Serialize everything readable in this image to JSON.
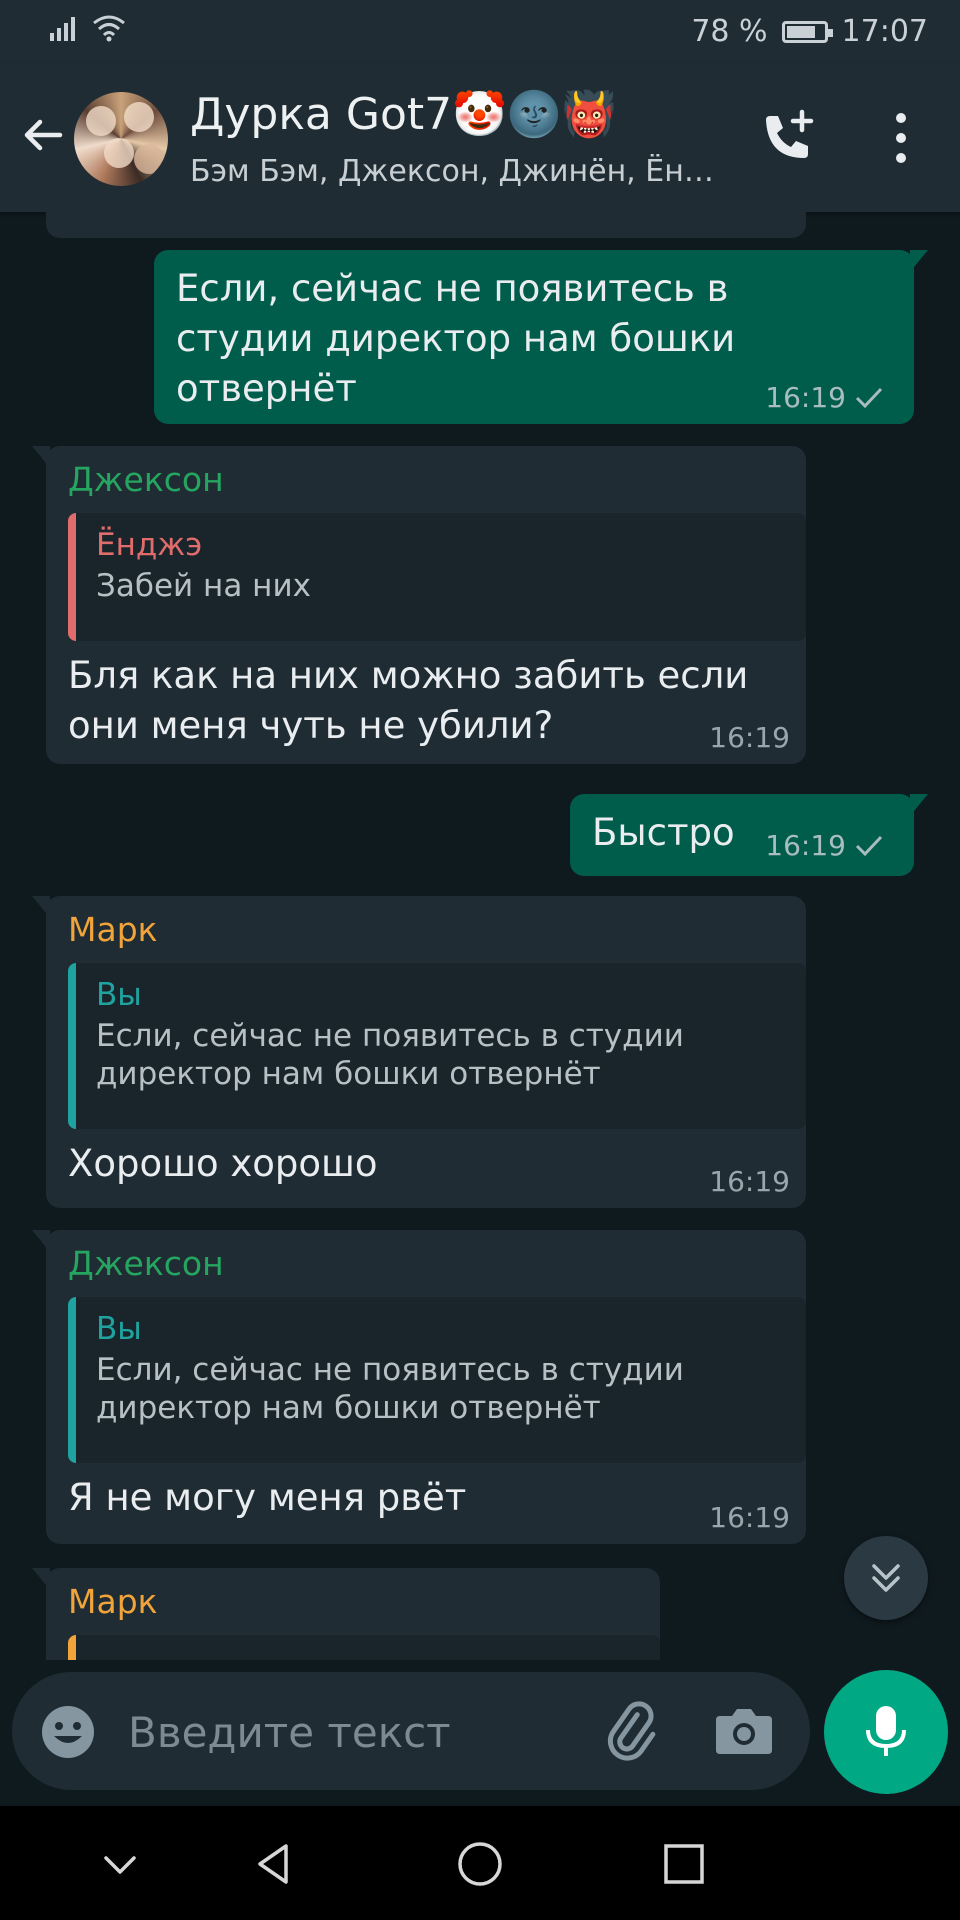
{
  "status_bar": {
    "battery_text": "78 %",
    "battery_level": 0.78,
    "time": "17:07",
    "icons": [
      "signal-icon",
      "wifi-icon",
      "battery-charging-icon"
    ]
  },
  "header": {
    "title": "Дурка Got7🤡🌚👹",
    "subtitle": "Бэм Бэм, Джексон, Джинён, Ён…",
    "icons": [
      "back-arrow-icon",
      "group-avatar",
      "add-call-icon",
      "more-vert-icon"
    ]
  },
  "messages": [
    {
      "direction": "out",
      "text": "Если, сейчас не появитесь в студии директор нам бошки отвернёт",
      "time": "16:19"
    },
    {
      "direction": "in",
      "sender": "Джексон",
      "sender_color": "#25a55f",
      "quote": {
        "name": "Ёнджэ",
        "text": "Забей на них",
        "color": "#e06c6c"
      },
      "text": "Бля как на них можно забить если они меня чуть не убили?",
      "time": "16:19"
    },
    {
      "direction": "out",
      "text": "Быстро",
      "time": "16:19"
    },
    {
      "direction": "in",
      "sender": "Марк",
      "sender_color": "#f0a43a",
      "quote": {
        "name": "Вы",
        "text": "Если, сейчас не появитесь в студии директор нам бошки отвернёт",
        "color": "#1fa3a0"
      },
      "text": "Хорошо хорошо",
      "time": "16:19"
    },
    {
      "direction": "in",
      "sender": "Джексон",
      "sender_color": "#25a55f",
      "quote": {
        "name": "Вы",
        "text": "Если, сейчас не появитесь в студии директор нам бошки отвернёт",
        "color": "#1fa3a0"
      },
      "text": "Я не могу меня рвёт",
      "time": "16:19"
    },
    {
      "direction": "in",
      "sender": "Марк",
      "sender_color": "#f0a43a"
    }
  ],
  "composer": {
    "placeholder": "Введите текст",
    "icons": [
      "emoji-icon",
      "attach-icon",
      "camera-icon",
      "mic-icon"
    ]
  },
  "colors": {
    "background": "#0f1a1f",
    "bar": "#1f2c33",
    "outgoing_bubble": "#005c4b",
    "incoming_bubble": "#1f2c34",
    "accent": "#00a884"
  }
}
